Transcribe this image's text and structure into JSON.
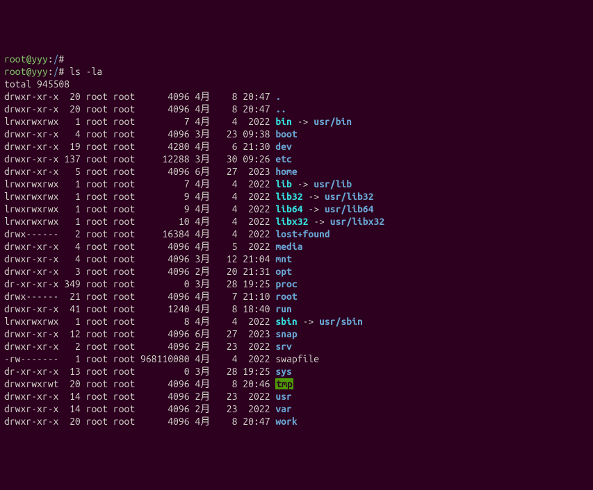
{
  "prompts": [
    {
      "user": "root@yyy",
      "path": "/",
      "cmd": ""
    },
    {
      "user": "root@yyy",
      "path": "/",
      "cmd": "ls -la"
    }
  ],
  "total": "total 945508",
  "entries": [
    {
      "perm": "drwxr-xr-x",
      "links": " 20",
      "own": "root",
      "grp": "root",
      "size": "     4096",
      "mon": "4月 ",
      "day": "  8",
      "time": "20:47",
      "name": ".",
      "cls": "dir"
    },
    {
      "perm": "drwxr-xr-x",
      "links": " 20",
      "own": "root",
      "grp": "root",
      "size": "     4096",
      "mon": "4月 ",
      "day": "  8",
      "time": "20:47",
      "name": "..",
      "cls": "dir"
    },
    {
      "perm": "lrwxrwxrwx",
      "links": "  1",
      "own": "root",
      "grp": "root",
      "size": "        7",
      "mon": "4月 ",
      "day": "  4",
      "time": " 2022",
      "name": "bin",
      "cls": "link",
      "arrow": " -> ",
      "target": "usr/bin"
    },
    {
      "perm": "drwxr-xr-x",
      "links": "  4",
      "own": "root",
      "grp": "root",
      "size": "     4096",
      "mon": "3月 ",
      "day": " 23",
      "time": "09:38",
      "name": "boot",
      "cls": "dir"
    },
    {
      "perm": "drwxr-xr-x",
      "links": " 19",
      "own": "root",
      "grp": "root",
      "size": "     4280",
      "mon": "4月 ",
      "day": "  6",
      "time": "21:30",
      "name": "dev",
      "cls": "dir"
    },
    {
      "perm": "drwxr-xr-x",
      "links": "137",
      "own": "root",
      "grp": "root",
      "size": "    12288",
      "mon": "3月 ",
      "day": " 30",
      "time": "09:26",
      "name": "etc",
      "cls": "dir"
    },
    {
      "perm": "drwxr-xr-x",
      "links": "  5",
      "own": "root",
      "grp": "root",
      "size": "     4096",
      "mon": "6月 ",
      "day": " 27",
      "time": " 2023",
      "name": "home",
      "cls": "dir"
    },
    {
      "perm": "lrwxrwxrwx",
      "links": "  1",
      "own": "root",
      "grp": "root",
      "size": "        7",
      "mon": "4月 ",
      "day": "  4",
      "time": " 2022",
      "name": "lib",
      "cls": "link",
      "arrow": " -> ",
      "target": "usr/lib"
    },
    {
      "perm": "lrwxrwxrwx",
      "links": "  1",
      "own": "root",
      "grp": "root",
      "size": "        9",
      "mon": "4月 ",
      "day": "  4",
      "time": " 2022",
      "name": "lib32",
      "cls": "link",
      "arrow": " -> ",
      "target": "usr/lib32"
    },
    {
      "perm": "lrwxrwxrwx",
      "links": "  1",
      "own": "root",
      "grp": "root",
      "size": "        9",
      "mon": "4月 ",
      "day": "  4",
      "time": " 2022",
      "name": "lib64",
      "cls": "link",
      "arrow": " -> ",
      "target": "usr/lib64"
    },
    {
      "perm": "lrwxrwxrwx",
      "links": "  1",
      "own": "root",
      "grp": "root",
      "size": "       10",
      "mon": "4月 ",
      "day": "  4",
      "time": " 2022",
      "name": "libx32",
      "cls": "link",
      "arrow": " -> ",
      "target": "usr/libx32"
    },
    {
      "perm": "drwx------",
      "links": "  2",
      "own": "root",
      "grp": "root",
      "size": "    16384",
      "mon": "4月 ",
      "day": "  4",
      "time": " 2022",
      "name": "lost+found",
      "cls": "dir"
    },
    {
      "perm": "drwxr-xr-x",
      "links": "  4",
      "own": "root",
      "grp": "root",
      "size": "     4096",
      "mon": "4月 ",
      "day": "  5",
      "time": " 2022",
      "name": "media",
      "cls": "dir"
    },
    {
      "perm": "drwxr-xr-x",
      "links": "  4",
      "own": "root",
      "grp": "root",
      "size": "     4096",
      "mon": "3月 ",
      "day": " 12",
      "time": "21:04",
      "name": "mnt",
      "cls": "dir"
    },
    {
      "perm": "drwxr-xr-x",
      "links": "  3",
      "own": "root",
      "grp": "root",
      "size": "     4096",
      "mon": "2月 ",
      "day": " 20",
      "time": "21:31",
      "name": "opt",
      "cls": "dir"
    },
    {
      "perm": "dr-xr-xr-x",
      "links": "349",
      "own": "root",
      "grp": "root",
      "size": "        0",
      "mon": "3月 ",
      "day": " 28",
      "time": "19:25",
      "name": "proc",
      "cls": "dir"
    },
    {
      "perm": "drwx------",
      "links": " 21",
      "own": "root",
      "grp": "root",
      "size": "     4096",
      "mon": "4月 ",
      "day": "  7",
      "time": "21:10",
      "name": "root",
      "cls": "dir"
    },
    {
      "perm": "drwxr-xr-x",
      "links": " 41",
      "own": "root",
      "grp": "root",
      "size": "     1240",
      "mon": "4月 ",
      "day": "  8",
      "time": "18:40",
      "name": "run",
      "cls": "dir"
    },
    {
      "perm": "lrwxrwxrwx",
      "links": "  1",
      "own": "root",
      "grp": "root",
      "size": "        8",
      "mon": "4月 ",
      "day": "  4",
      "time": " 2022",
      "name": "sbin",
      "cls": "link",
      "arrow": " -> ",
      "target": "usr/sbin"
    },
    {
      "perm": "drwxr-xr-x",
      "links": " 12",
      "own": "root",
      "grp": "root",
      "size": "     4096",
      "mon": "6月 ",
      "day": " 27",
      "time": " 2023",
      "name": "snap",
      "cls": "dir"
    },
    {
      "perm": "drwxr-xr-x",
      "links": "  2",
      "own": "root",
      "grp": "root",
      "size": "     4096",
      "mon": "2月 ",
      "day": " 23",
      "time": " 2022",
      "name": "srv",
      "cls": "dir"
    },
    {
      "perm": "-rw-------",
      "links": "  1",
      "own": "root",
      "grp": "root",
      "size": "968110080",
      "mon": "4月 ",
      "day": "  4",
      "time": " 2022",
      "name": "swapfile",
      "cls": "plain"
    },
    {
      "perm": "dr-xr-xr-x",
      "links": " 13",
      "own": "root",
      "grp": "root",
      "size": "        0",
      "mon": "3月 ",
      "day": " 28",
      "time": "19:25",
      "name": "sys",
      "cls": "dir"
    },
    {
      "perm": "drwxrwxrwt",
      "links": " 20",
      "own": "root",
      "grp": "root",
      "size": "     4096",
      "mon": "4月 ",
      "day": "  8",
      "time": "20:46",
      "name": "tmp",
      "cls": "tmp"
    },
    {
      "perm": "drwxr-xr-x",
      "links": " 14",
      "own": "root",
      "grp": "root",
      "size": "     4096",
      "mon": "2月 ",
      "day": " 23",
      "time": " 2022",
      "name": "usr",
      "cls": "dir"
    },
    {
      "perm": "drwxr-xr-x",
      "links": " 14",
      "own": "root",
      "grp": "root",
      "size": "     4096",
      "mon": "2月 ",
      "day": " 23",
      "time": " 2022",
      "name": "var",
      "cls": "dir"
    },
    {
      "perm": "drwxr-xr-x",
      "links": " 20",
      "own": "root",
      "grp": "root",
      "size": "     4096",
      "mon": "4月 ",
      "day": "  8",
      "time": "20:47",
      "name": "work",
      "cls": "dir"
    }
  ]
}
